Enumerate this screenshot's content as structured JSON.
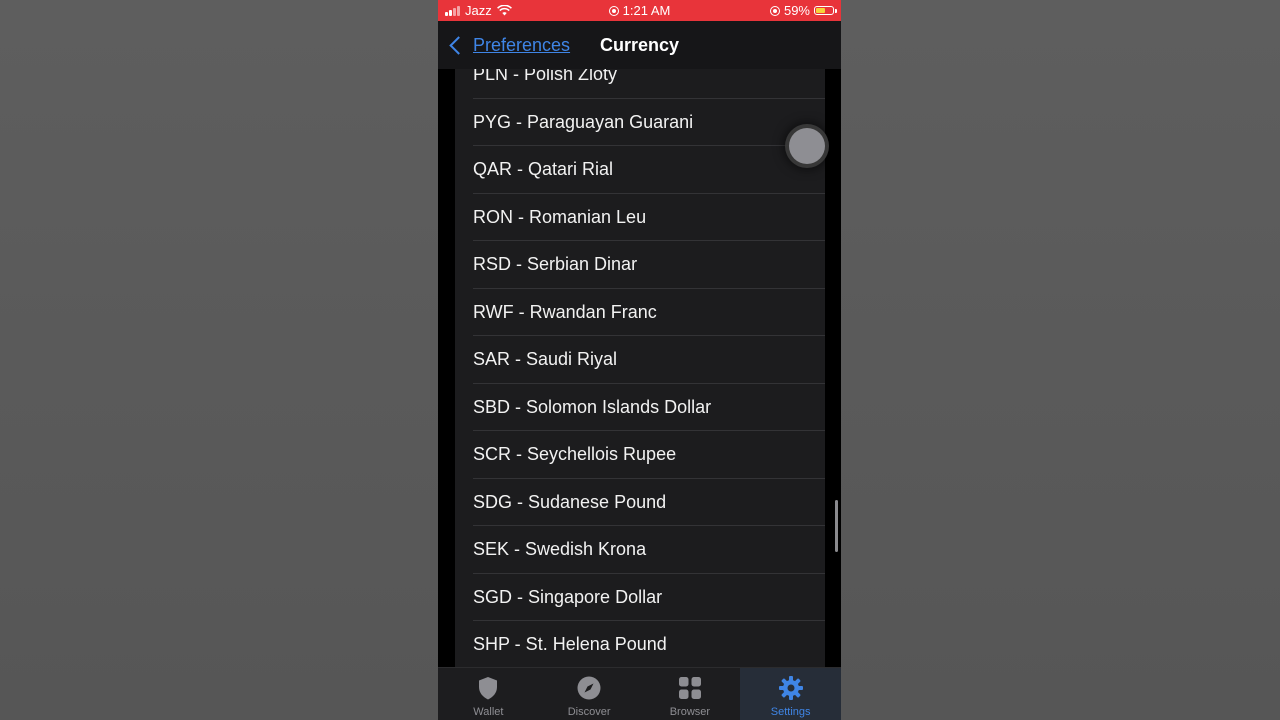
{
  "status_bar": {
    "carrier": "Jazz",
    "time": "1:21 AM",
    "battery_percent": "59%",
    "battery_level": 0.59,
    "background_color": "#e8343a",
    "icons": [
      "signal-icon",
      "wifi-icon",
      "alarm-icon",
      "orientation-lock-icon",
      "battery-icon"
    ]
  },
  "nav": {
    "back_label": "Preferences",
    "title": "Currency",
    "accent_color": "#3f85e6"
  },
  "currencies": [
    "PLN - Polish Zloty",
    "PYG - Paraguayan Guarani",
    "QAR - Qatari Rial",
    "RON - Romanian Leu",
    "RSD - Serbian Dinar",
    "RWF - Rwandan Franc",
    "SAR - Saudi Riyal",
    "SBD - Solomon Islands Dollar",
    "SCR - Seychellois Rupee",
    "SDG - Sudanese Pound",
    "SEK - Swedish Krona",
    "SGD - Singapore Dollar",
    "SHP - St. Helena Pound"
  ],
  "tab_bar": {
    "tabs": [
      {
        "label": "Wallet",
        "icon": "shield-icon",
        "active": false
      },
      {
        "label": "Discover",
        "icon": "compass-icon",
        "active": false
      },
      {
        "label": "Browser",
        "icon": "grid-icon",
        "active": false
      },
      {
        "label": "Settings",
        "icon": "gear-icon",
        "active": true
      }
    ]
  }
}
